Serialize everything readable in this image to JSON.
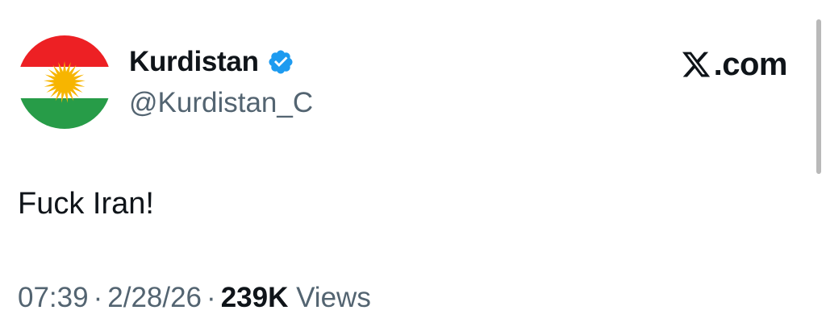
{
  "author": {
    "display_name": "Kurdistan",
    "handle": "@Kurdistan_C",
    "verified": true,
    "avatar_icon": "kurdistan-flag-icon"
  },
  "brand": {
    "logo_icon": "x-logo-icon",
    "text": ".com"
  },
  "tweet": {
    "text": "Fuck Iran!"
  },
  "meta": {
    "time": "07:39",
    "separator": "·",
    "date": "2/28/26",
    "views_count": "239K",
    "views_label": "Views"
  },
  "colors": {
    "verified_blue": "#1d9bf0",
    "secondary_text": "#536471",
    "primary_text": "#0f1419",
    "flag_red": "#ed2024",
    "flag_green": "#279c48",
    "flag_sun": "#f7b500"
  }
}
